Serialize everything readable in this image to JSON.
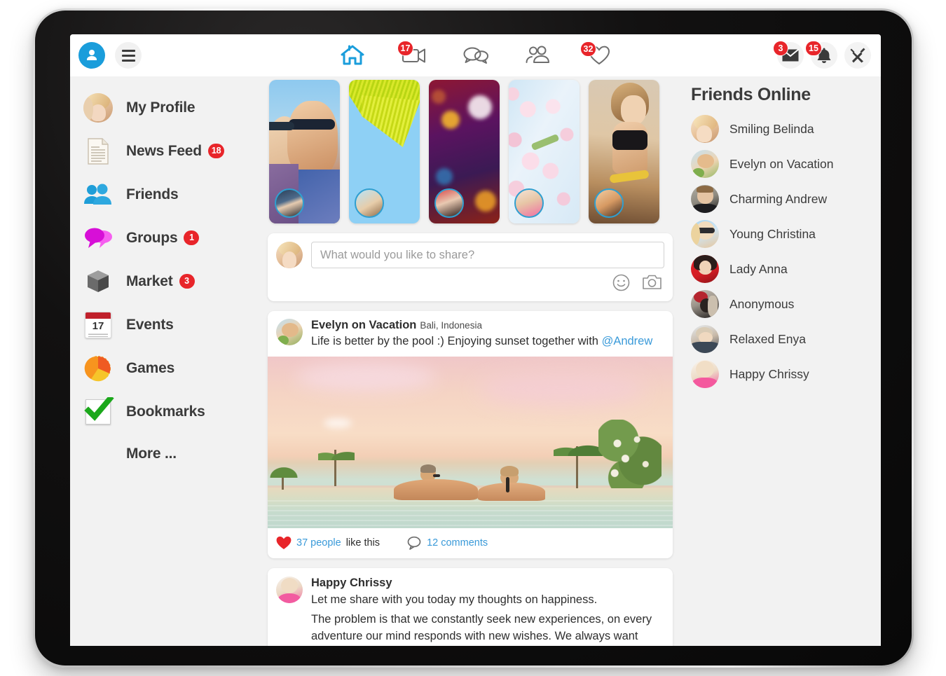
{
  "topnav": {
    "profile_icon": "user-avatar-icon",
    "menu_icon": "hamburger-menu-icon",
    "center_items": [
      {
        "name": "home",
        "icon": "home-icon",
        "badge": ""
      },
      {
        "name": "video",
        "icon": "video-camera-icon",
        "badge": "17"
      },
      {
        "name": "messages",
        "icon": "chat-bubbles-icon",
        "badge": ""
      },
      {
        "name": "friends",
        "icon": "people-icon",
        "badge": ""
      },
      {
        "name": "likes",
        "icon": "heart-outline-icon",
        "badge": "32"
      }
    ],
    "right_items": [
      {
        "name": "mail",
        "icon": "envelope-icon",
        "badge": "3"
      },
      {
        "name": "notifications",
        "icon": "bell-icon",
        "badge": "15"
      },
      {
        "name": "settings",
        "icon": "tools-icon",
        "badge": ""
      }
    ]
  },
  "sidebar": {
    "items": [
      {
        "label": "My Profile",
        "icon": "profile-photo-icon",
        "badge": ""
      },
      {
        "label": "News Feed",
        "icon": "document-icon",
        "badge": "18"
      },
      {
        "label": "Friends",
        "icon": "people-blue-icon",
        "badge": ""
      },
      {
        "label": "Groups",
        "icon": "speech-bubbles-magenta-icon",
        "badge": "1"
      },
      {
        "label": "Market",
        "icon": "box-icon",
        "badge": "3"
      },
      {
        "label": "Events",
        "icon": "calendar-icon",
        "badge": ""
      },
      {
        "label": "Games",
        "icon": "flower-rosette-icon",
        "badge": ""
      },
      {
        "label": "Bookmarks",
        "icon": "green-checkmark-icon",
        "badge": ""
      }
    ],
    "more_label": "More ...",
    "events_calendar_day": "17"
  },
  "stories": [
    {
      "name": "story-couple-sunglasses"
    },
    {
      "name": "story-palm-leaf"
    },
    {
      "name": "story-bokeh-lights"
    },
    {
      "name": "story-cherry-blossom"
    },
    {
      "name": "story-fitness-woman"
    }
  ],
  "compose": {
    "placeholder": "What would you like to share?",
    "value": "",
    "emoji_icon": "smiley-face-icon",
    "camera_icon": "camera-icon"
  },
  "posts": [
    {
      "author": "Evelyn on Vacation",
      "location": "Bali, Indonesia",
      "text_before_mention": "Life is better by the pool :) Enjoying sunset together with ",
      "mention": "@Andrew",
      "image": "infinity-pool-sunset-photo",
      "likes_count": "37 people",
      "likes_suffix": "like this",
      "comments": "12 comments",
      "heart_icon": "heart-filled-icon",
      "comment_icon": "comment-bubble-icon"
    },
    {
      "author": "Happy Chrissy",
      "line1": "Let me share with you today my thoughts on happiness.",
      "line2": "The problem is that we constantly seek new experiences, on every adventure our mind responds with new wishes. We always want something more and better. But happiness lies in not needing more"
    }
  ],
  "friends_online": {
    "title": "Friends Online",
    "items": [
      {
        "name": "Smiling Belinda"
      },
      {
        "name": "Evelyn on Vacation"
      },
      {
        "name": "Charming Andrew"
      },
      {
        "name": "Young Christina"
      },
      {
        "name": "Lady Anna"
      },
      {
        "name": "Anonymous"
      },
      {
        "name": "Relaxed Enya"
      },
      {
        "name": "Happy Chrissy"
      }
    ]
  },
  "colors": {
    "badge_red": "#e8252a",
    "brand_blue": "#1a9ddb",
    "link_blue": "#3a9ad9",
    "page_bg": "#f2f2f2",
    "card_white": "#ffffff",
    "text_dark": "#3b3b3b"
  }
}
